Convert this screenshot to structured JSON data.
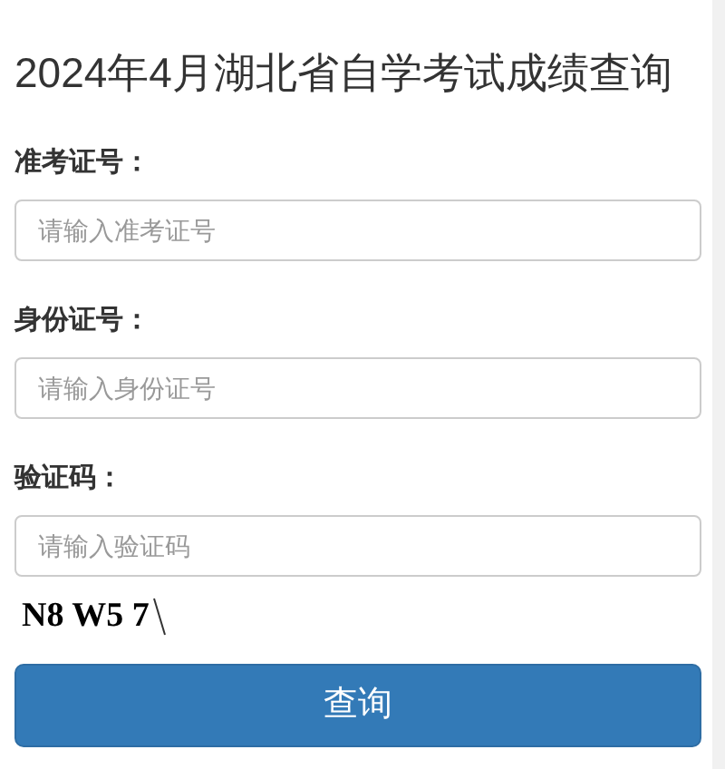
{
  "title": "2024年4月湖北省自学考试成绩查询",
  "fields": [
    {
      "label": "准考证号：",
      "placeholder": "请输入准考证号"
    },
    {
      "label": "身份证号：",
      "placeholder": "请输入身份证号"
    },
    {
      "label": "验证码：",
      "placeholder": "请输入验证码"
    }
  ],
  "captcha": "N8 W5 7",
  "button": "查询"
}
